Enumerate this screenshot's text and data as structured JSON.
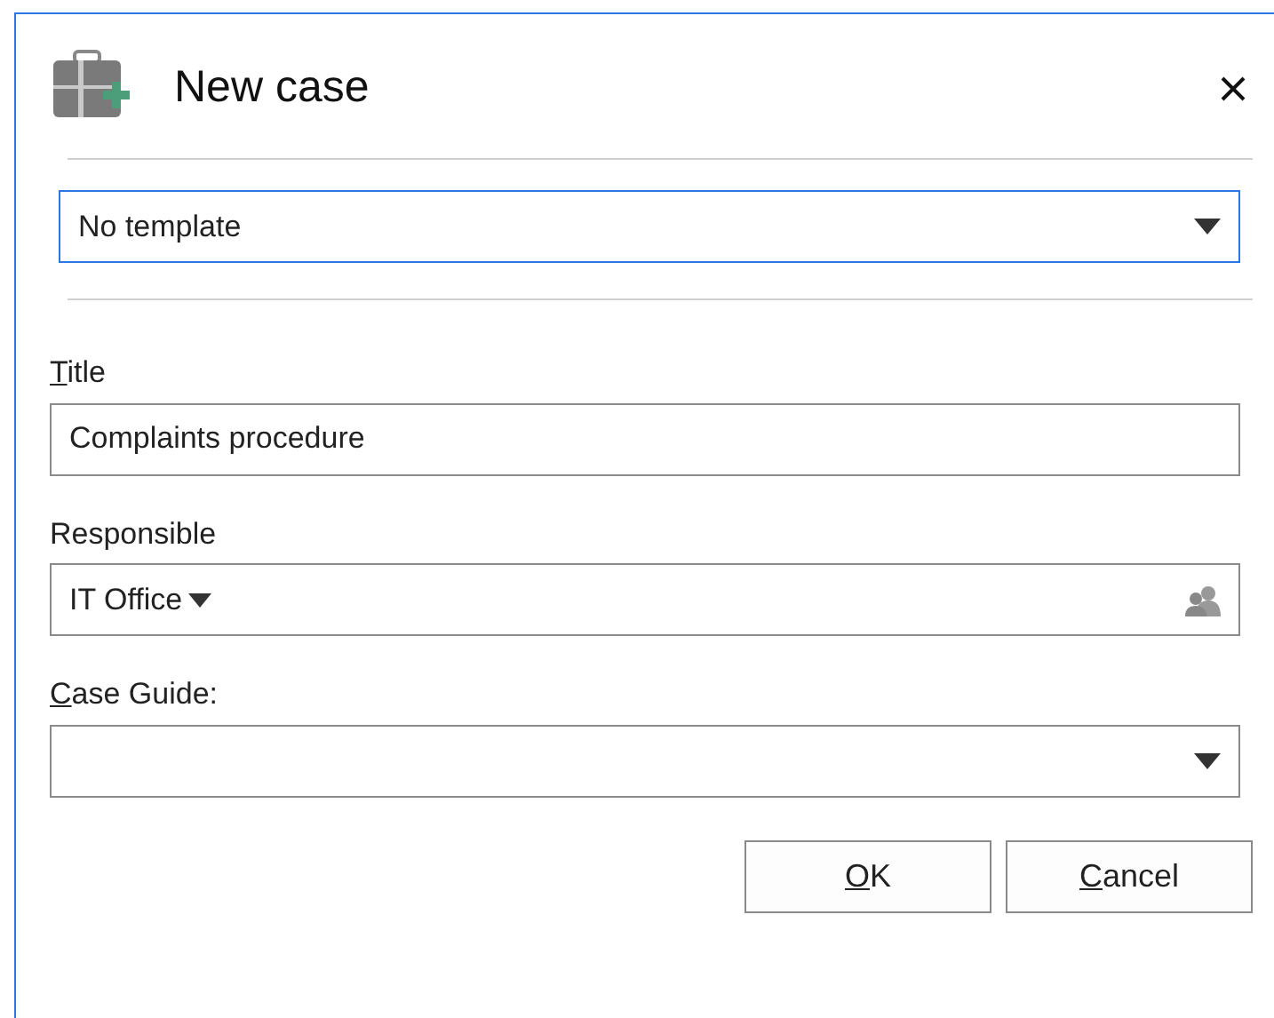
{
  "window": {
    "title": "New case"
  },
  "template": {
    "value": "No template",
    "focused": true
  },
  "fields": [
    {
      "kind": "text",
      "label": "Title",
      "access_key_underlined": true,
      "value": "Complaints procedure"
    },
    {
      "kind": "person",
      "label": "Responsible",
      "access_key_underlined": false,
      "value": "IT Office"
    },
    {
      "kind": "select",
      "label": "Case Guide:",
      "access_key_underlined": true
    }
  ],
  "buttons": [
    {
      "label": "OK",
      "access_key_underlined": true
    },
    {
      "label": "Cancel",
      "access_key_underlined": true
    }
  ]
}
